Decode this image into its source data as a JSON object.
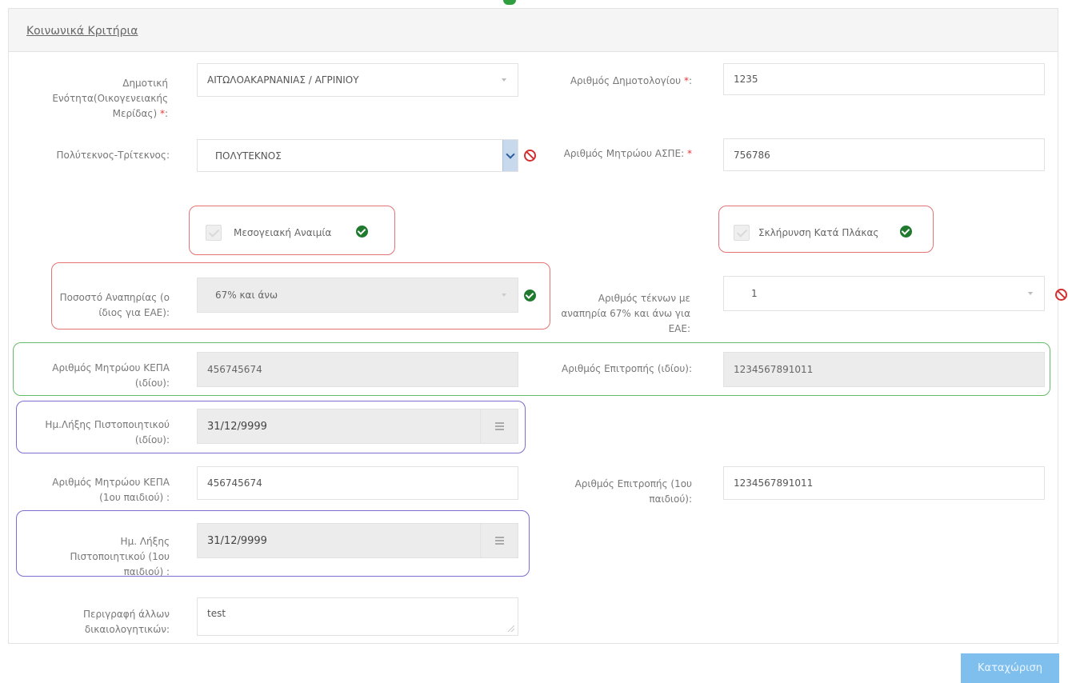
{
  "panel": {
    "title": "Κοινωνικά Κριτήρια"
  },
  "fields": {
    "municipality_label": "Δημοτική Ενότητα(Οικογενειακής Μερίδας)",
    "municipality_value": "ΑΙΤΩΛΟΑΚΑΡΝΑΝΙΑΣ / ΑΓΡΙΝΙΟΥ",
    "registry_no_label": "Αριθμός Δημοτολογίου",
    "registry_no_value": "1235",
    "multi_child_label": "Πολύτεκνος-Τρίτεκνος:",
    "multi_child_value": "ΠΟΛΥΤΕΚΝΟΣ",
    "aspe_label": "Αριθμός Μητρώου ΑΣΠΕ:",
    "aspe_value": "756786",
    "anemia_label": "Μεσογειακή Αναιμία",
    "sclerosis_label": "Σκλήρυνση Κατά Πλάκας",
    "disability_pct_label": "Ποσοστό Αναπηρίας (ο ίδιος για ΕΑΕ):",
    "disability_pct_value": "67% και άνω",
    "children_disabled_label": "Αριθμός τέκνων με αναπηρία 67% και άνω για ΕΑΕ:",
    "children_disabled_value": "1",
    "kepa_self_label": "Αριθμός Μητρώου ΚΕΠΑ (ιδίου):",
    "kepa_self_value": "456745674",
    "committee_self_label": "Αριθμός Επιτροπής (ιδίου):",
    "committee_self_value": "1234567891011",
    "cert_expiry_self_label": "Ημ.Λήξης Πιστοποιητικού (ιδίου):",
    "cert_expiry_self_value": "31/12/9999",
    "kepa_child_label": "Αριθμός Μητρώου ΚΕΠΑ (1ου παιδιού) :",
    "kepa_child_value": "456745674",
    "committee_child_label": "Αριθμός Επιτροπής (1ου παιδιού):",
    "committee_child_value": "1234567891011",
    "cert_expiry_child_label": "Ημ. Λήξης Πιστοποιητικού (1ου παιδιού) :",
    "cert_expiry_child_value": "31/12/9999",
    "other_docs_label": "Περιγραφή άλλων δικαιολογητικών:",
    "other_docs_value": "test"
  },
  "required_mark": "*",
  "colon": ":",
  "actions": {
    "save_label": "Καταχώριση"
  },
  "colors": {
    "valid": "#1f7a2e",
    "invalid": "#d32f2f",
    "accent": "#7fbfee"
  }
}
